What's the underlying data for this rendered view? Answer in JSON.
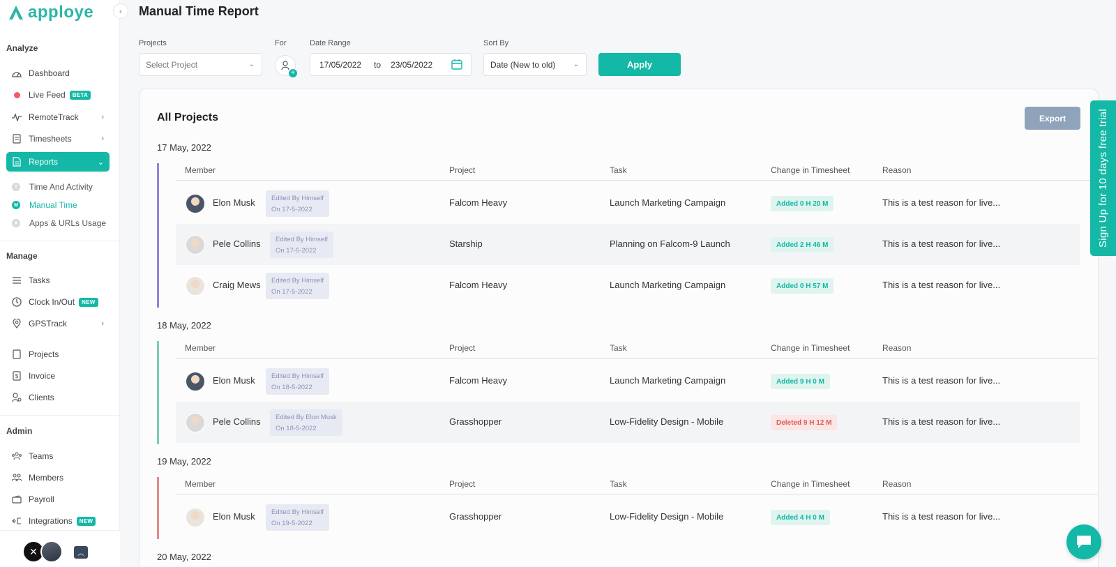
{
  "app": {
    "name": "apploye"
  },
  "sidebar": {
    "analyze_title": "Analyze",
    "manage_title": "Manage",
    "admin_title": "Admin",
    "analyze": [
      {
        "label": "Dashboard",
        "icon": "dashboard-icon"
      },
      {
        "label": "Live Feed",
        "icon": "live-dot-icon",
        "badge": "BETA"
      },
      {
        "label": "RemoteTrack",
        "icon": "activity-icon"
      },
      {
        "label": "Timesheets",
        "icon": "timesheet-icon"
      },
      {
        "label": "Reports",
        "icon": "report-icon"
      }
    ],
    "reports_sub": [
      {
        "label": "Time And Activity",
        "letter": "T"
      },
      {
        "label": "Manual Time",
        "letter": "M"
      },
      {
        "label": "Apps & URLs Usage",
        "letter": "A"
      }
    ],
    "manage": [
      {
        "label": "Tasks",
        "icon": "tasks-icon"
      },
      {
        "label": "Clock In/Out",
        "icon": "clock-icon",
        "badge": "NEW"
      },
      {
        "label": "GPSTrack",
        "icon": "location-icon"
      },
      {
        "label": "Projects",
        "icon": "projects-icon"
      },
      {
        "label": "Invoice",
        "icon": "invoice-icon"
      },
      {
        "label": "Clients",
        "icon": "clients-icon"
      }
    ],
    "admin": [
      {
        "label": "Teams",
        "icon": "teams-icon"
      },
      {
        "label": "Members",
        "icon": "members-icon"
      },
      {
        "label": "Payroll",
        "icon": "payroll-icon"
      },
      {
        "label": "Integrations",
        "icon": "integrations-icon",
        "badge": "NEW"
      }
    ]
  },
  "header": {
    "title": "Manual Time Report"
  },
  "filters": {
    "projects_label": "Projects",
    "projects_placeholder": "Select Project",
    "for_label": "For",
    "date_range_label": "Date Range",
    "date_from": "17/05/2022",
    "date_to_word": "to",
    "date_to": "23/05/2022",
    "sort_label": "Sort By",
    "sort_value": "Date (New to old)",
    "apply_label": "Apply"
  },
  "report": {
    "title": "All Projects",
    "export_label": "Export",
    "columns": {
      "member": "Member",
      "project": "Project",
      "task": "Task",
      "change": "Change in Timesheet",
      "reason": "Reason"
    },
    "groups": [
      {
        "date": "17 May, 2022",
        "accent": "#8b87d6",
        "rows": [
          {
            "member": "Elon Musk",
            "edited_by": "Edited By Himself",
            "edited_on": "On 17-5-2022",
            "project": "Falcom Heavy",
            "task": "Launch Marketing Campaign",
            "change": "Added 0 H 20 M",
            "change_type": "added",
            "reason": "This is a test reason for live..."
          },
          {
            "member": "Pele Collins",
            "edited_by": "Edited By Himself",
            "edited_on": "On 17-5-2022",
            "project": "Starship",
            "task": "Planning on Falcom-9 Launch",
            "change": "Added 2 H 46 M",
            "change_type": "added",
            "reason": "This is a test reason for live..."
          },
          {
            "member": "Craig Mews",
            "edited_by": "Edited By Himself",
            "edited_on": "On 17-5-2022",
            "project": "Falcom Heavy",
            "task": "Launch Marketing Campaign",
            "change": "Added 0 H 57 M",
            "change_type": "added",
            "reason": "This is a test reason for live..."
          }
        ]
      },
      {
        "date": "18 May, 2022",
        "accent": "#7ccbb4",
        "rows": [
          {
            "member": "Elon Musk",
            "edited_by": "Edited By Himself",
            "edited_on": "On 18-5-2022",
            "project": "Falcom Heavy",
            "task": "Launch Marketing Campaign",
            "change": "Added 9 H 0 M",
            "change_type": "added",
            "reason": "This is a test reason for live..."
          },
          {
            "member": "Pele Collins",
            "edited_by": "Edited By Elon Musk",
            "edited_on": "On 18-5-2022",
            "project": "Grasshopper",
            "task": "Low-Fidelity Design - Mobile",
            "change": "Deleted 9 H 12 M",
            "change_type": "deleted",
            "reason": "This is a test reason for live..."
          }
        ]
      },
      {
        "date": "19 May, 2022",
        "accent": "#e58a8a",
        "rows": [
          {
            "member": "Elon Musk",
            "edited_by": "Edited By Himself",
            "edited_on": "On 19-5-2022",
            "project": "Grasshopper",
            "task": "Low-Fidelity Design - Mobile",
            "change": "Added 4 H 0 M",
            "change_type": "added",
            "reason": "This is a test reason for live..."
          }
        ]
      },
      {
        "date": "20 May, 2022",
        "rows": []
      }
    ]
  },
  "promo": {
    "signup_label": "Sign Up for 10 days free trial"
  },
  "colors": {
    "accent": "#14b8a6",
    "export": "#8fa4ba",
    "deleted": "#e05a5a"
  }
}
